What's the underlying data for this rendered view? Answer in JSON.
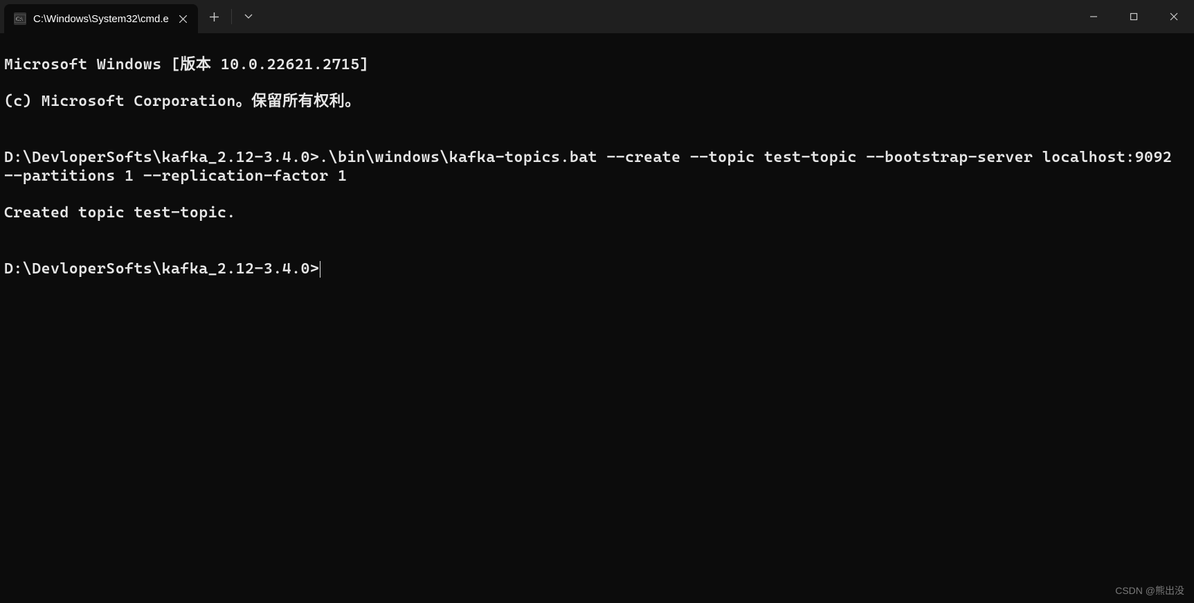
{
  "titlebar": {
    "tab": {
      "icon_name": "cmd-icon",
      "title": "C:\\Windows\\System32\\cmd.e",
      "close_label": "Close"
    },
    "new_tab_label": "New tab",
    "dropdown_label": "Tab options"
  },
  "window_controls": {
    "minimize": "Minimize",
    "maximize": "Maximize",
    "close": "Close"
  },
  "terminal": {
    "lines": [
      "Microsoft Windows [版本 10.0.22621.2715]",
      "(c) Microsoft Corporation。保留所有权利。",
      "",
      "D:\\DevloperSofts\\kafka_2.12-3.4.0>.\\bin\\windows\\kafka-topics.bat --create --topic test-topic --bootstrap-server localhost:9092 --partitions 1 --replication-factor 1",
      "Created topic test-topic.",
      "",
      "D:\\DevloperSofts\\kafka_2.12-3.4.0>"
    ]
  },
  "watermark": "CSDN @熊出没"
}
